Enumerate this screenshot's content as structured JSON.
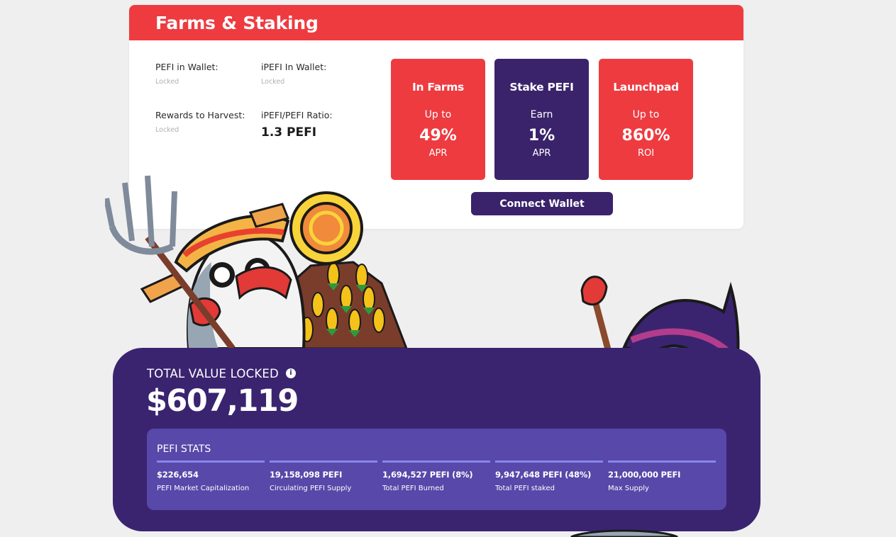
{
  "header": {
    "title": "Farms & Staking"
  },
  "wallet_stats": {
    "pefi_in_wallet": {
      "label": "PEFI in Wallet:",
      "value": "Locked"
    },
    "ipefi_in_wallet": {
      "label": "iPEFI In Wallet:",
      "value": "Locked"
    },
    "rewards_to_harvest": {
      "label": "Rewards to Harvest:",
      "value": "Locked"
    },
    "ipefi_pefi_ratio": {
      "label": "iPEFI/PEFI Ratio:",
      "value": "1.3 PEFI"
    }
  },
  "tiles": [
    {
      "title": "In Farms",
      "subtitle": "Up to",
      "value": "49%",
      "unit": "APR"
    },
    {
      "title": "Stake PEFI",
      "subtitle": "Earn",
      "value": "1%",
      "unit": "APR"
    },
    {
      "title": "Launchpad",
      "subtitle": "Up to",
      "value": "860%",
      "unit": "ROI"
    }
  ],
  "connect_button": "Connect Wallet",
  "tvl": {
    "label": "TOTAL VALUE LOCKED",
    "value": "$607,119",
    "info_icon": "info-icon"
  },
  "pefi_stats": {
    "title": "PEFI STATS",
    "items": [
      {
        "value": "$226,654",
        "label": "PEFI Market Capitalization"
      },
      {
        "value": "19,158,098 PEFI",
        "label": "Circulating PEFI Supply"
      },
      {
        "value": "1,694,527 PEFI (8%)",
        "label": "Total PEFI Burned"
      },
      {
        "value": "9,947,648 PEFI (48%)",
        "label": "Total PEFI staked"
      },
      {
        "value": "21,000,000 PEFI",
        "label": "Max Supply"
      }
    ]
  },
  "colors": {
    "accent_red": "#ee3b40",
    "accent_purple": "#3a236b",
    "stats_bg": "#5748a9",
    "stats_bar": "#8a87ec"
  }
}
